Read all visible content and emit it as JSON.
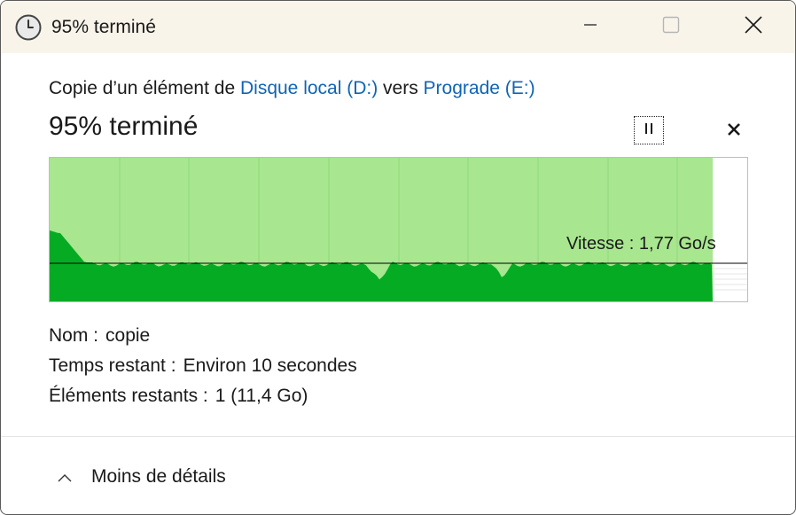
{
  "window": {
    "title": "95% terminé",
    "title_icon": "clock-icon",
    "controls": {
      "minimize_icon": "minimize-icon",
      "maximize_icon": "maximize-icon",
      "close_icon": "close-icon"
    }
  },
  "copy": {
    "prefix": "Copie d’un élément de ",
    "source": "Disque local (D:)",
    "middle": " vers ",
    "destination": "Prograde (E:)"
  },
  "progress": {
    "percent_text": "95% terminé",
    "fraction_complete": 0.95,
    "pause_icon": "pause-icon",
    "cancel_icon": "cancel-icon"
  },
  "speed_graph": {
    "speed_label": "Vitesse : 1,77 Go/s",
    "colors": {
      "progress_fill": "#a8e690",
      "speed_fill": "#06ab24",
      "gridline": "#8fd87a",
      "speed_line": "#000000"
    }
  },
  "details": {
    "name_label": "Nom :",
    "name_value": "copie",
    "time_label": "Temps restant :",
    "time_value": "Environ 10 secondes",
    "items_label": "Éléments restants :",
    "items_value": "1 (11,4 Go)"
  },
  "toggle": {
    "label": "Moins de détails",
    "icon": "chevron-up-icon"
  }
}
